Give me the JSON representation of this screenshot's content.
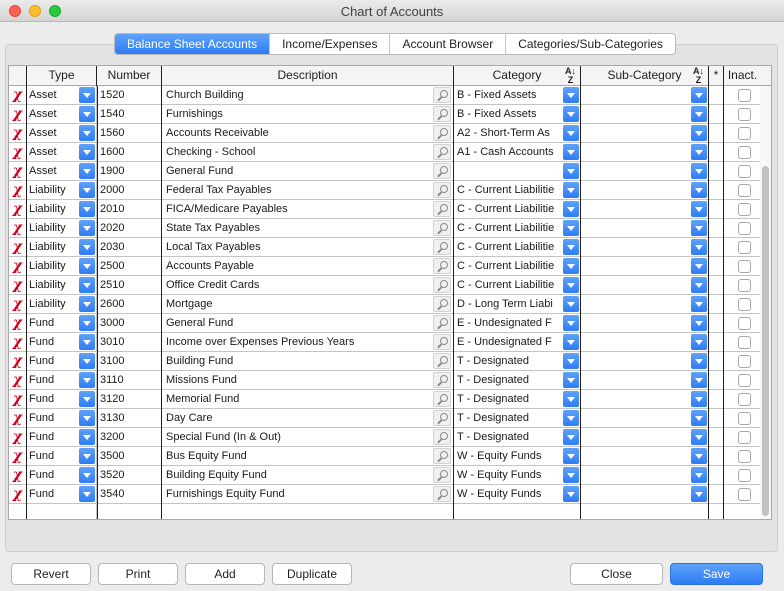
{
  "window": {
    "title": "Chart of Accounts"
  },
  "tabs": [
    "Balance Sheet Accounts",
    "Income/Expenses",
    "Account Browser",
    "Categories/Sub-Categories"
  ],
  "columns": {
    "type": "Type",
    "number": "Number",
    "description": "Description",
    "category": "Category",
    "subcategory": "Sub-Category",
    "star": "*",
    "inactive": "Inact."
  },
  "rows": [
    {
      "type": "Asset",
      "number": "1520",
      "description": "Church Building",
      "category": "B - Fixed Assets"
    },
    {
      "type": "Asset",
      "number": "1540",
      "description": "Furnishings",
      "category": "B - Fixed Assets"
    },
    {
      "type": "Asset",
      "number": "1560",
      "description": "Accounts Receivable",
      "category": "A2 - Short-Term As"
    },
    {
      "type": "Asset",
      "number": "1600",
      "description": "Checking - School",
      "category": "A1 - Cash Accounts"
    },
    {
      "type": "Asset",
      "number": "1900",
      "description": "General Fund",
      "category": ""
    },
    {
      "type": "Liability",
      "number": "2000",
      "description": "Federal Tax Payables",
      "category": "C - Current Liabilitie"
    },
    {
      "type": "Liability",
      "number": "2010",
      "description": "FICA/Medicare Payables",
      "category": "C - Current Liabilitie"
    },
    {
      "type": "Liability",
      "number": "2020",
      "description": "State Tax Payables",
      "category": "C - Current Liabilitie"
    },
    {
      "type": "Liability",
      "number": "2030",
      "description": "Local Tax Payables",
      "category": "C - Current Liabilitie"
    },
    {
      "type": "Liability",
      "number": "2500",
      "description": "Accounts Payable",
      "category": "C - Current Liabilitie"
    },
    {
      "type": "Liability",
      "number": "2510",
      "description": "Office Credit Cards",
      "category": "C - Current Liabilitie"
    },
    {
      "type": "Liability",
      "number": "2600",
      "description": "Mortgage",
      "category": "D - Long Term Liabi"
    },
    {
      "type": "Fund",
      "number": "3000",
      "description": "General Fund",
      "category": "E - Undesignated F"
    },
    {
      "type": "Fund",
      "number": "3010",
      "description": "Income over Expenses Previous Years",
      "category": "E - Undesignated F"
    },
    {
      "type": "Fund",
      "number": "3100",
      "description": "Building Fund",
      "category": "T - Designated"
    },
    {
      "type": "Fund",
      "number": "3110",
      "description": "Missions Fund",
      "category": "T - Designated"
    },
    {
      "type": "Fund",
      "number": "3120",
      "description": "Memorial Fund",
      "category": "T - Designated"
    },
    {
      "type": "Fund",
      "number": "3130",
      "description": "Day Care",
      "category": "T - Designated"
    },
    {
      "type": "Fund",
      "number": "3200",
      "description": "Special Fund (In & Out)",
      "category": "T - Designated"
    },
    {
      "type": "Fund",
      "number": "3500",
      "description": "Bus Equity Fund",
      "category": "W - Equity Funds"
    },
    {
      "type": "Fund",
      "number": "3520",
      "description": "Building Equity Fund",
      "category": "W - Equity Funds"
    },
    {
      "type": "Fund",
      "number": "3540",
      "description": "Furnishings Equity Fund",
      "category": "W - Equity Funds"
    }
  ],
  "buttons": {
    "revert": "Revert",
    "print": "Print",
    "add": "Add",
    "duplicate": "Duplicate",
    "close": "Close",
    "save": "Save"
  }
}
